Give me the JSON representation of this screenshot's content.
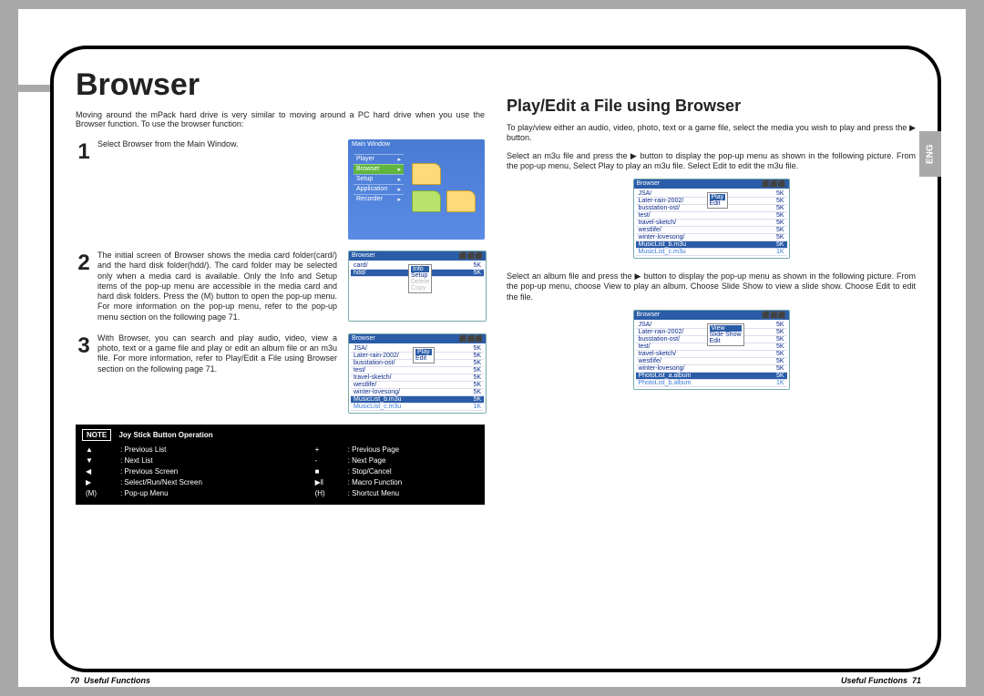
{
  "page": {
    "title": "Browser",
    "intro": "Moving around the mPack hard drive is very similar to moving around a PC hard drive when you use the Browser function. To use the browser function:",
    "lang_tab": "ENG"
  },
  "steps": {
    "s1": {
      "num": "1",
      "text": "Select Browser from the Main Window."
    },
    "s2": {
      "num": "2",
      "text": "The initial screen of Browser shows the media card folder(card/) and the hard disk folder(hdd/). The card folder may be selected only when a media card is available. Only the Info and Setup items of the pop-up menu are accessible in the media card and hard disk folders. Press the (M) button to open the pop-up menu. For more information on the pop-up menu, refer to the pop-up menu section on the following page 71."
    },
    "s3": {
      "num": "3",
      "text": "With Browser, you can search and play audio, video, view a photo, text or a game file and play or edit an album file or an m3u file. For more information, refer to Play/Edit a File using Browser section on the following page 71."
    }
  },
  "mainwin": {
    "title": "Main Window",
    "menu": [
      "Player",
      "Browser",
      "Setup",
      "Application",
      "Recorder"
    ]
  },
  "browser2": {
    "header": "Browser",
    "rows": [
      {
        "name": "card/",
        "size": "5K"
      },
      {
        "name": "hdd/",
        "size": "5K",
        "sel": true
      }
    ],
    "popup": [
      "Info",
      "Setup",
      "Delete",
      "Copy"
    ]
  },
  "browser3": {
    "header": "Browser",
    "rows": [
      {
        "name": "JSA/",
        "size": "5K"
      },
      {
        "name": "Later-rain-2002/",
        "size": "5K"
      },
      {
        "name": "busstation-ost/",
        "size": "5K"
      },
      {
        "name": "test/",
        "size": "5K"
      },
      {
        "name": "travel-sketch/",
        "size": "5K"
      },
      {
        "name": "westlife/",
        "size": "5K"
      },
      {
        "name": "winter-lovesong/",
        "size": "5K"
      },
      {
        "name": "MusicList_b.m3u",
        "size": "5K",
        "sel": true
      },
      {
        "name": "MusicList_c.m3u",
        "size": "1K",
        "light": true
      }
    ],
    "popup": [
      "Play",
      "Edit"
    ]
  },
  "note": {
    "label": "NOTE",
    "title": "Joy Stick Button Operation",
    "rows": [
      [
        "▲",
        "Previous List",
        "+",
        "Previous Page"
      ],
      [
        "▼",
        "Next List",
        "-",
        "Next Page"
      ],
      [
        "◀",
        "Previous Screen",
        "■",
        "Stop/Cancel"
      ],
      [
        "▶",
        "Select/Run/Next Screen",
        "▶‖",
        "Macro Function"
      ],
      [
        "(M)",
        "Pop-up Menu",
        "(H)",
        "Shortcut Menu"
      ]
    ]
  },
  "right": {
    "heading": "Play/Edit a File using Browser",
    "p1": "To play/view either an audio, video, photo, text or a game file, select the media you wish to play and press the ▶ button.",
    "p2": "Select an m3u file and press the ▶ button to display the pop-up menu as shown in the following picture. From the pop-up menu, Select Play to play an m3u file. Select Edit to edit the m3u file.",
    "p3": "Select an album file and press the ▶ button to display the pop-up menu as shown in the following picture. From the pop-up menu, choose View to play an album. Choose Slide Show to view a slide show. Choose Edit to edit the file."
  },
  "browserR1": {
    "header": "Browser",
    "rows": [
      {
        "name": "JSA/",
        "size": "5K"
      },
      {
        "name": "Later-rain-2002/",
        "size": "5K"
      },
      {
        "name": "busstation-ost/",
        "size": "5K"
      },
      {
        "name": "test/",
        "size": "5K"
      },
      {
        "name": "travel-sketch/",
        "size": "5K"
      },
      {
        "name": "westlife/",
        "size": "5K"
      },
      {
        "name": "winter-lovesong/",
        "size": "5K"
      },
      {
        "name": "MusicList_b.m3u",
        "size": "5K",
        "sel": true
      },
      {
        "name": "MusicList_c.m3u",
        "size": "1K",
        "light": true
      }
    ],
    "popup": [
      "Play",
      "Edit"
    ]
  },
  "browserR2": {
    "header": "Browser",
    "rows": [
      {
        "name": "JSA/",
        "size": "5K"
      },
      {
        "name": "Later-rain-2002/",
        "size": "5K"
      },
      {
        "name": "busstation-ost/",
        "size": "5K"
      },
      {
        "name": "test/",
        "size": "5K"
      },
      {
        "name": "travel-sketch/",
        "size": "5K"
      },
      {
        "name": "westlife/",
        "size": "5K"
      },
      {
        "name": "winter-lovesong/",
        "size": "5K"
      },
      {
        "name": "PhotoList_a.album",
        "size": "5K",
        "sel": true
      },
      {
        "name": "PhotoList_b.album",
        "size": "1K",
        "light": true
      }
    ],
    "popup": [
      "View",
      "Slide Show",
      "Edit"
    ]
  },
  "footer": {
    "left_num": "70",
    "section": "Useful Functions",
    "right_num": "71"
  }
}
